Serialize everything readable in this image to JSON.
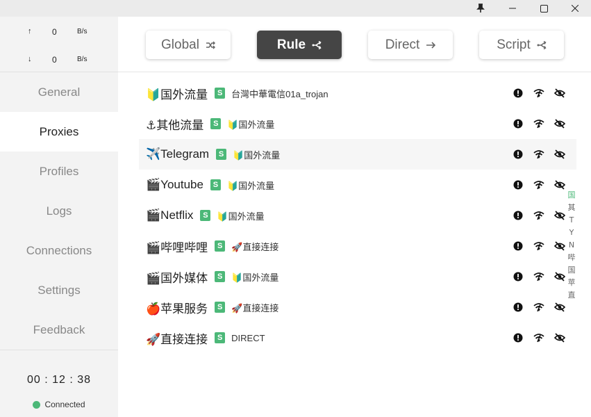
{
  "titlebar": {
    "buttons": [
      {
        "name": "pin",
        "icon": "pin-icon"
      },
      {
        "name": "minimize",
        "icon": "minimize-icon"
      },
      {
        "name": "maximize",
        "icon": "maximize-icon"
      },
      {
        "name": "close",
        "icon": "close-icon"
      }
    ]
  },
  "traffic": {
    "upload": {
      "arrow": "↑",
      "value": "0",
      "unit": "B/s"
    },
    "download": {
      "arrow": "↓",
      "value": "0",
      "unit": "B/s"
    }
  },
  "nav": {
    "items": [
      "General",
      "Proxies",
      "Profiles",
      "Logs",
      "Connections",
      "Settings",
      "Feedback"
    ],
    "active": "Proxies"
  },
  "status": {
    "uptime": "00 : 12 : 38",
    "state": "Connected",
    "color": "#4cb878"
  },
  "modes": {
    "items": [
      {
        "label": "Global",
        "icon": "shuffle-icon"
      },
      {
        "label": "Rule",
        "icon": "split-icon"
      },
      {
        "label": "Direct",
        "icon": "arrow-right-icon"
      },
      {
        "label": "Script",
        "icon": "split-icon"
      }
    ],
    "active": "Rule"
  },
  "proxies": {
    "groups": [
      {
        "name": "🔰国外流量",
        "badge": "S",
        "selected": "台灣中華電信01a_trojan"
      },
      {
        "name": "⚓其他流量",
        "badge": "S",
        "selected": "🔰国外流量"
      },
      {
        "name": "✈️Telegram",
        "badge": "S",
        "selected": "🔰国外流量"
      },
      {
        "name": "🎬Youtube",
        "badge": "S",
        "selected": "🔰国外流量"
      },
      {
        "name": "🎬Netflix",
        "badge": "S",
        "selected": "🔰国外流量"
      },
      {
        "name": "🎬哔哩哔哩",
        "badge": "S",
        "selected": "🚀直接连接"
      },
      {
        "name": "🎬国外媒体",
        "badge": "S",
        "selected": "🔰国外流量"
      },
      {
        "name": "🍎苹果服务",
        "badge": "S",
        "selected": "🚀直接连接"
      },
      {
        "name": "🚀直接连接",
        "badge": "S",
        "selected": "DIRECT"
      }
    ],
    "row_icons": [
      "alert-circle-icon",
      "latency-wifi-icon",
      "eye-off-icon"
    ],
    "highlighted_row": 2
  },
  "jump_index": [
    "国",
    "其",
    "T",
    "Y",
    "N",
    "哔",
    "国",
    "苹",
    "直"
  ],
  "colors": {
    "accent": "#4cb878",
    "active_mode_bg": "#454545",
    "sidebar_bg": "#f3f3f3"
  }
}
